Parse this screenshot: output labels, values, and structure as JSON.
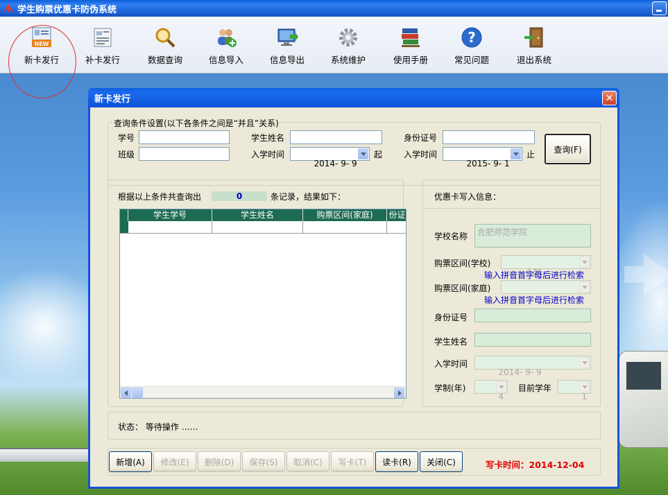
{
  "app": {
    "title": "学生购票优惠卡防伪系统"
  },
  "toolbar": {
    "items": [
      {
        "label": "新卡发行",
        "icon": "new-card-icon"
      },
      {
        "label": "补卡发行",
        "icon": "reissue-card-icon"
      },
      {
        "label": "数据查询",
        "icon": "magnifier-icon"
      },
      {
        "label": "信息导入",
        "icon": "import-users-icon"
      },
      {
        "label": "信息导出",
        "icon": "export-monitor-icon"
      },
      {
        "label": "系统维护",
        "icon": "gear-icon"
      },
      {
        "label": "使用手册",
        "icon": "books-icon"
      },
      {
        "label": "常见问题",
        "icon": "help-icon"
      },
      {
        "label": "退出系统",
        "icon": "exit-door-icon"
      }
    ]
  },
  "dialog": {
    "title": "新卡发行",
    "query": {
      "legend": "查询条件设置(以下各条件之间是“并且”关系)",
      "student_id_label": "学号",
      "student_id_value": "",
      "student_name_label": "学生姓名",
      "student_name_value": "",
      "id_card_label": "身份证号",
      "id_card_value": "",
      "class_label": "班级",
      "class_value": "",
      "enroll_from_label": "入学时间",
      "enroll_from_value": "2014- 9- 9",
      "from_suffix": "起",
      "enroll_to_label": "入学时间",
      "enroll_to_value": "2015- 9- 1",
      "to_suffix": "止",
      "query_button": "查询(F)"
    },
    "results": {
      "prefix": "根据以上条件共查询出",
      "count": "0",
      "suffix": "条记录，结果如下：",
      "columns": [
        "学生学号",
        "学生姓名",
        "购票区间(家庭)",
        "份证"
      ]
    },
    "card_info": {
      "heading": "优惠卡写入信息：",
      "school_name_label": "学校名称",
      "school_name_value": "合肥师范学院",
      "school_section_label": "购票区间(学校)",
      "school_section_value": "合肥",
      "hint1": "输入拼音首字母后进行检索",
      "home_section_label": "购票区间(家庭)",
      "home_section_value": "",
      "hint2": "输入拼音首字母后进行检索",
      "id_card_label": "身份证号",
      "student_name_label": "学生姓名",
      "enroll_label": "入学时间",
      "enroll_value": "2014- 9- 9",
      "duration_label": "学制(年)",
      "duration_value": "4",
      "current_year_label": "目前学年",
      "current_year_value": "1"
    },
    "status": {
      "text": "状态：  等待操作  ……"
    },
    "buttons": {
      "add": "新增(A)",
      "edit": "修改(E)",
      "delete": "删除(D)",
      "save": "保存(S)",
      "cancel": "取消(C)",
      "write": "写卡(T)",
      "read": "读卡(R)",
      "close": "关闭(C)"
    },
    "write_time": "写卡时间：2014-12-04"
  },
  "colors": {
    "title_bar": "#1d64d6",
    "dialog_bg": "#ece9d8",
    "grid_header": "#1d6b52",
    "count_bg": "#c8dfcc",
    "hint": "#0000c8",
    "write_time": "#e00000"
  }
}
